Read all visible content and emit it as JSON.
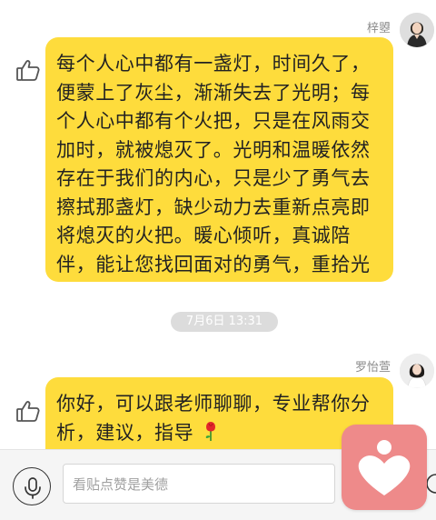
{
  "messages": [
    {
      "sender": "梓曌",
      "text": "每个人心中都有一盏灯，时间久了，便蒙上了灰尘，渐渐失去了光明；每个人心中都有个火把，只是在风雨交加时，就被熄灭了。光明和温暖依然存在于我们的内心，只是少了勇气去擦拭那盏灯，缺少动力去重新点亮即将熄灭的火把。暖心倾听，真诚陪伴，能让您找回面对的勇气，重拾光明和温暖！"
    },
    {
      "sender": "罗怡萱",
      "text": "你好，可以跟老师聊聊，专业帮你分析，建议，指导",
      "emoji": "rose"
    }
  ],
  "timestamp": "7月6日 13:31",
  "input": {
    "placeholder": "看贴点赞是美德"
  },
  "colors": {
    "bubble": "#fedc3c",
    "fab": "#ee8a8a"
  },
  "icons": [
    "like-icon",
    "microphone-icon",
    "heart-person-icon",
    "chevron-right-icon",
    "rose-emoji-icon"
  ]
}
